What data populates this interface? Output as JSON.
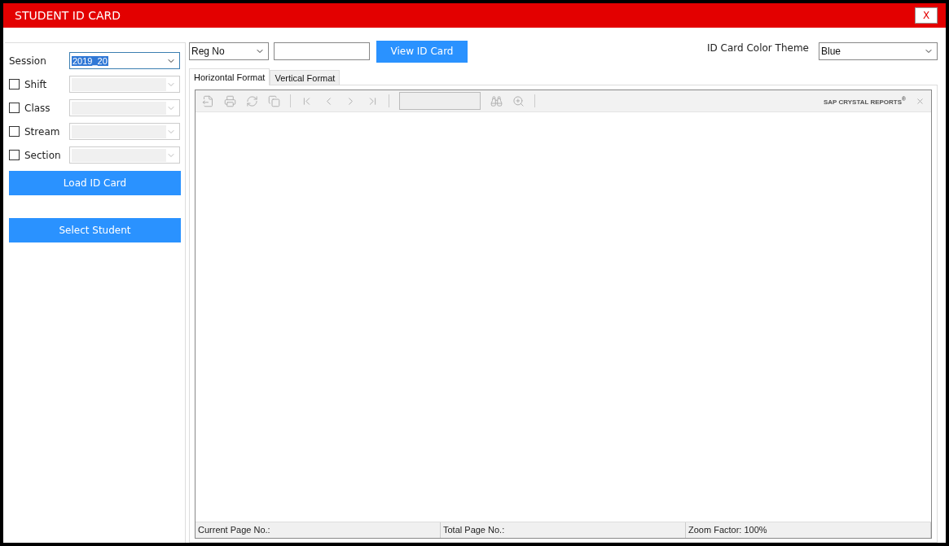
{
  "window": {
    "title": "STUDENT ID CARD",
    "close": "X"
  },
  "session": {
    "label": "Session",
    "value": "2019_20"
  },
  "filters": [
    {
      "label": "Shift",
      "checked": false
    },
    {
      "label": "Class",
      "checked": false
    },
    {
      "label": "Stream",
      "checked": false
    },
    {
      "label": "Section",
      "checked": false
    }
  ],
  "left_buttons": [
    "Load ID Card",
    "Select Student"
  ],
  "search": {
    "field": "Reg No",
    "button": "View ID Card"
  },
  "theme": {
    "label": "ID Card Color Theme",
    "value": "Blue"
  },
  "tabs": [
    {
      "label": "Horizontal Format",
      "selected": true
    },
    {
      "label": "Vertical Format",
      "selected": false
    }
  ],
  "viewer": {
    "brand": "SAP CRYSTAL REPORTS$^{®}$"
  },
  "status_bar": [
    "Current Page No.:",
    "Total Page No.:",
    "Zoom Factor: 100%"
  ]
}
